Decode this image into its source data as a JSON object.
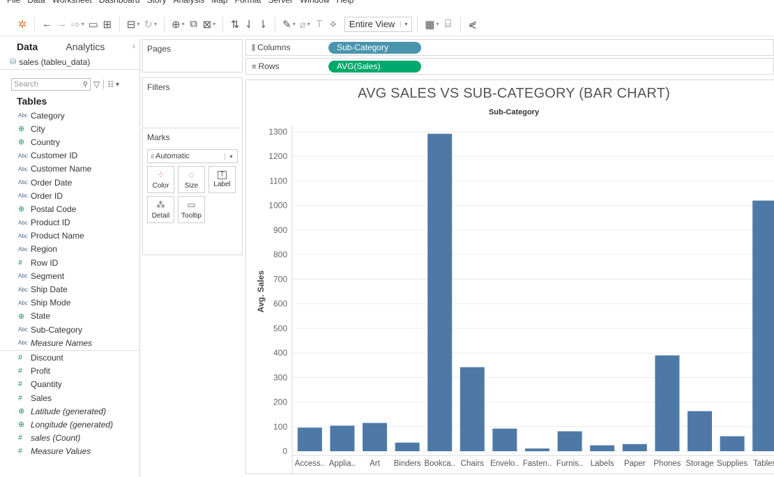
{
  "menubar": {
    "items": [
      "File",
      "Data",
      "Worksheet",
      "Dashboard",
      "Story",
      "Analysis",
      "Map",
      "Format",
      "Server",
      "Window",
      "Help"
    ]
  },
  "toolbar": {
    "fit": "Entire View"
  },
  "data_pane": {
    "tab_data": "Data",
    "tab_analytics": "Analytics",
    "collapse": "‹",
    "datasource": "sales (tableu_data)",
    "search_placeholder": "Search",
    "tables_heading": "Tables",
    "dimensions": [
      {
        "name": "Category",
        "type": "abc"
      },
      {
        "name": "City",
        "type": "geo"
      },
      {
        "name": "Country",
        "type": "geo"
      },
      {
        "name": "Customer ID",
        "type": "abc"
      },
      {
        "name": "Customer Name",
        "type": "abc"
      },
      {
        "name": "Order Date",
        "type": "abc"
      },
      {
        "name": "Order ID",
        "type": "abc"
      },
      {
        "name": "Postal Code",
        "type": "geo"
      },
      {
        "name": "Product ID",
        "type": "abc"
      },
      {
        "name": "Product Name",
        "type": "abc"
      },
      {
        "name": "Region",
        "type": "abc"
      },
      {
        "name": "Row ID",
        "type": "num"
      },
      {
        "name": "Segment",
        "type": "abc"
      },
      {
        "name": "Ship Date",
        "type": "abc"
      },
      {
        "name": "Ship Mode",
        "type": "abc"
      },
      {
        "name": "State",
        "type": "geo"
      },
      {
        "name": "Sub-Category",
        "type": "abc"
      },
      {
        "name": "Measure Names",
        "type": "abc",
        "italic": true
      }
    ],
    "measures": [
      {
        "name": "Discount",
        "type": "num"
      },
      {
        "name": "Profit",
        "type": "num"
      },
      {
        "name": "Quantity",
        "type": "num"
      },
      {
        "name": "Sales",
        "type": "num"
      },
      {
        "name": "Latitude (generated)",
        "type": "geo",
        "italic": true
      },
      {
        "name": "Longitude (generated)",
        "type": "geo",
        "italic": true
      },
      {
        "name": "sales (Count)",
        "type": "num",
        "italic": true
      },
      {
        "name": "Measure Values",
        "type": "num",
        "italic": true
      }
    ]
  },
  "cards": {
    "pages": "Pages",
    "filters": "Filters",
    "marks": "Marks",
    "mark_type": "Automatic",
    "mark_buttons": [
      "Color",
      "Size",
      "Label",
      "Detail",
      "Tooltip"
    ]
  },
  "shelves": {
    "columns_label": "Columns",
    "columns_pill": "Sub-Category",
    "rows_label": "Rows",
    "rows_pill": "AVG(Sales)"
  },
  "colors": {
    "bar": "#4e79a7",
    "dimension_pill": "#4995ae",
    "measure_pill": "#00a86b"
  },
  "chart_data": {
    "type": "bar",
    "title": "AVG SALES VS SUB-CATEGORY (BAR CHART)",
    "xlabel": "Sub-Category",
    "ylabel": "Avg. Sales",
    "ylim": [
      0,
      1300
    ],
    "yticks": [
      0,
      100,
      200,
      300,
      400,
      500,
      600,
      700,
      800,
      900,
      1000,
      1100,
      1200,
      1300
    ],
    "categories": [
      "Access..",
      "Applia..",
      "Art",
      "Binders",
      "Bookca..",
      "Chairs",
      "Envelo..",
      "Fasten..",
      "Furnis..",
      "Labels",
      "Paper",
      "Phones",
      "Storage",
      "Supplies",
      "Tables"
    ],
    "values": [
      96,
      104,
      115,
      35,
      1292,
      342,
      92,
      11,
      81,
      24,
      29,
      390,
      163,
      61,
      1020
    ],
    "grid": true
  }
}
